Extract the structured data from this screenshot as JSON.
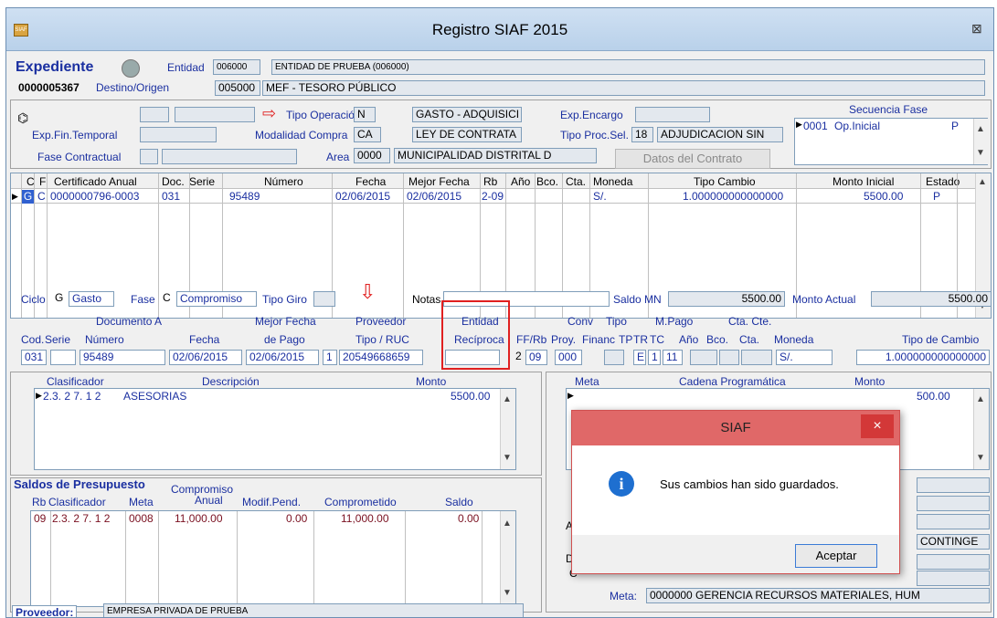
{
  "window": {
    "title": "Registro SIAF 2015",
    "icon": "siaf-icon",
    "close": "⊠"
  },
  "exp": {
    "label": "Expediente",
    "number": "0000005367",
    "entidad_label": "Entidad",
    "entidad_code": "006000",
    "entidad_name": "ENTIDAD DE PRUEBA (006000)",
    "destino_label": "Destino/Origen",
    "destino_code": "005000",
    "destino_name": "MEF - TESORO PÚBLICO"
  },
  "head": {
    "tipo_operacion_label": "Tipo Operación",
    "tipo_operacion_code": "N",
    "tipo_operacion_name": "GASTO - ADQUISICI",
    "exp_encargo_label": "Exp.Encargo",
    "exp_fin_label": "Exp.Fin.Temporal",
    "modalidad_label": "Modalidad Compra",
    "modalidad_code": "CA",
    "modalidad_name": "LEY DE CONTRATA",
    "tipo_proc_label": "Tipo Proc.Sel.",
    "tipo_proc_code": "18",
    "tipo_proc_name": "ADJUDICACION SIN",
    "fase_contractual_label": "Fase Contractual",
    "area_label": "Area",
    "area_code": "0000",
    "area_name": "MUNICIPALIDAD DISTRITAL D",
    "datos_contrato": "Datos del Contrato"
  },
  "secuencia": {
    "title": "Secuencia Fase",
    "row_num": "0001",
    "row_name": "Op.Inicial",
    "row_state": "P"
  },
  "grid": {
    "headers": [
      "C",
      "F",
      "Certificado Anual",
      "Doc.",
      "Serie",
      "Número",
      "Fecha",
      "Mejor Fecha",
      "Rb",
      "Año",
      "Bco.",
      "Cta.",
      "Moneda",
      "Tipo Cambio",
      "Monto Inicial",
      "Estado"
    ],
    "row": [
      "G",
      "C",
      "0000000796-0003",
      "031",
      "",
      "95489",
      "02/06/2015",
      "02/06/2015",
      "2-09",
      "",
      "",
      "",
      "S/.",
      "1.000000000000000",
      "5500.00",
      "P"
    ]
  },
  "ciclo": {
    "ciclo_label": "Ciclo",
    "ciclo_code": "G",
    "ciclo_name": "Gasto",
    "fase_label": "Fase",
    "fase_code": "C",
    "fase_name": "Compromiso",
    "tipo_giro_label": "Tipo Giro",
    "notas_label": "Notas",
    "saldo_label": "Saldo MN",
    "saldo_value": "5500.00",
    "monto_actual_label": "Monto Actual",
    "monto_actual_value": "5500.00"
  },
  "doc": {
    "documento_a": "Documento A",
    "mejor_fecha": "Mejor Fecha",
    "proveedor": "Proveedor",
    "entidad": "Entidad",
    "reciproca": "Recíproca",
    "conv": "Conv",
    "tipo": "Tipo",
    "m_pago": "M.Pago",
    "cta_cte": "Cta. Cte.",
    "cod": "Cod.",
    "serie": "Serie",
    "numero": "Número",
    "fecha": "Fecha",
    "de_pago": "de Pago",
    "tipo_ruc": "Tipo / RUC",
    "ff_rb": "FF/Rb",
    "proy": "Proy.",
    "financ": "Financ",
    "tp": "TP",
    "tr": "TR",
    "tc": "TC",
    "anio": "Año",
    "bco": "Bco.",
    "cta": "Cta.",
    "moneda": "Moneda",
    "tipo_cambio": "Tipo de Cambio",
    "v_cod": "031",
    "v_numero": "95489",
    "v_fecha": "02/06/2015",
    "v_depago": "02/06/2015",
    "v_tipo": "1",
    "v_ruc": "20549668659",
    "v_ff": "2",
    "v_rb": "09",
    "v_proy": "000",
    "v_tp": "E",
    "v_tr": "1",
    "v_tc": "11",
    "v_moneda": "S/.",
    "v_tipo_cambio": "1.000000000000000"
  },
  "clasif": {
    "h_clasificador": "Clasificador",
    "h_descripcion": "Descripción",
    "h_monto": "Monto",
    "code": "2.3. 2 7. 1 2",
    "desc": "ASESORIAS",
    "monto": "5500.00"
  },
  "meta": {
    "h_meta": "Meta",
    "h_cadena": "Cadena Programática",
    "h_monto": "Monto",
    "monto": "500.00",
    "contingency": "CONTINGE",
    "bottom_label": "Meta:",
    "bottom_text": "0000000 GERENCIA RECURSOS MATERIALES, HUM",
    "l_a": "A",
    "l_di": "Di",
    "l_c": "C"
  },
  "saldos": {
    "title": "Saldos de Presupuesto",
    "h_rb": "Rb",
    "h_clasificador": "Clasificador",
    "h_meta": "Meta",
    "h_compromiso": "Compromiso",
    "h_anual": "Anual",
    "h_modif": "Modif.Pend.",
    "h_comprometido": "Comprometido",
    "h_saldo": "Saldo",
    "rb": "09",
    "clas": "2.3. 2 7. 1 2",
    "meta": "0008",
    "anual": "11,000.00",
    "modif": "0.00",
    "comprometido": "11,000.00",
    "saldo": "0.00"
  },
  "proveedor": {
    "label": "Proveedor:",
    "name": "EMPRESA PRIVADA DE PRUEBA"
  },
  "dialog": {
    "title": "SIAF",
    "message": "Sus cambios han sido guardados.",
    "button": "Aceptar",
    "close": "×",
    "info_icon": "i"
  },
  "colors": {
    "title_bar": "#c7dbef",
    "dialog_title": "#e05a5a",
    "highlight": "#e02020",
    "field_text": "#1a2fa0",
    "info_blue": "#1e6fd0"
  }
}
